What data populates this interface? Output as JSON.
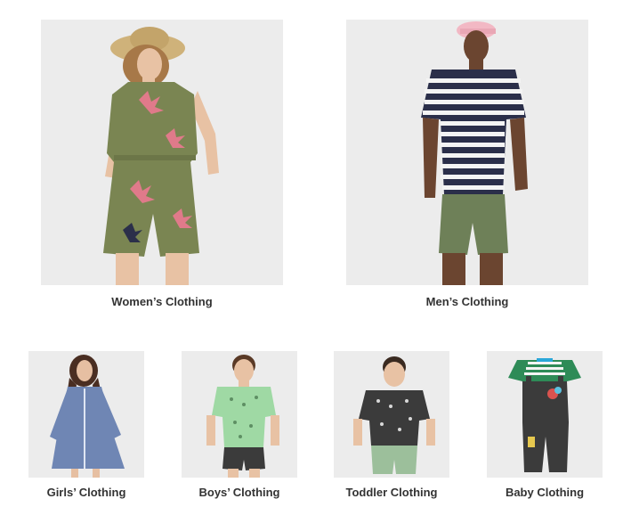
{
  "categories": {
    "women": {
      "label": "Women’s Clothing",
      "icon": "women-model-photo"
    },
    "men": {
      "label": "Men’s Clothing",
      "icon": "men-model-photo"
    },
    "girls": {
      "label": "Girls’ Clothing",
      "icon": "girl-model-photo"
    },
    "boys": {
      "label": "Boys’ Clothing",
      "icon": "boy-model-photo"
    },
    "toddler": {
      "label": "Toddler Clothing",
      "icon": "toddler-model-photo"
    },
    "baby": {
      "label": "Baby Clothing",
      "icon": "baby-overalls-photo"
    }
  },
  "colors": {
    "tile_bg": "#ececec",
    "label_text": "#333333",
    "olive": "#7a8552",
    "navy": "#2b2f4a",
    "denim": "#6f86b4",
    "mint": "#9fd9a4",
    "charcoal": "#3b3b3b"
  }
}
